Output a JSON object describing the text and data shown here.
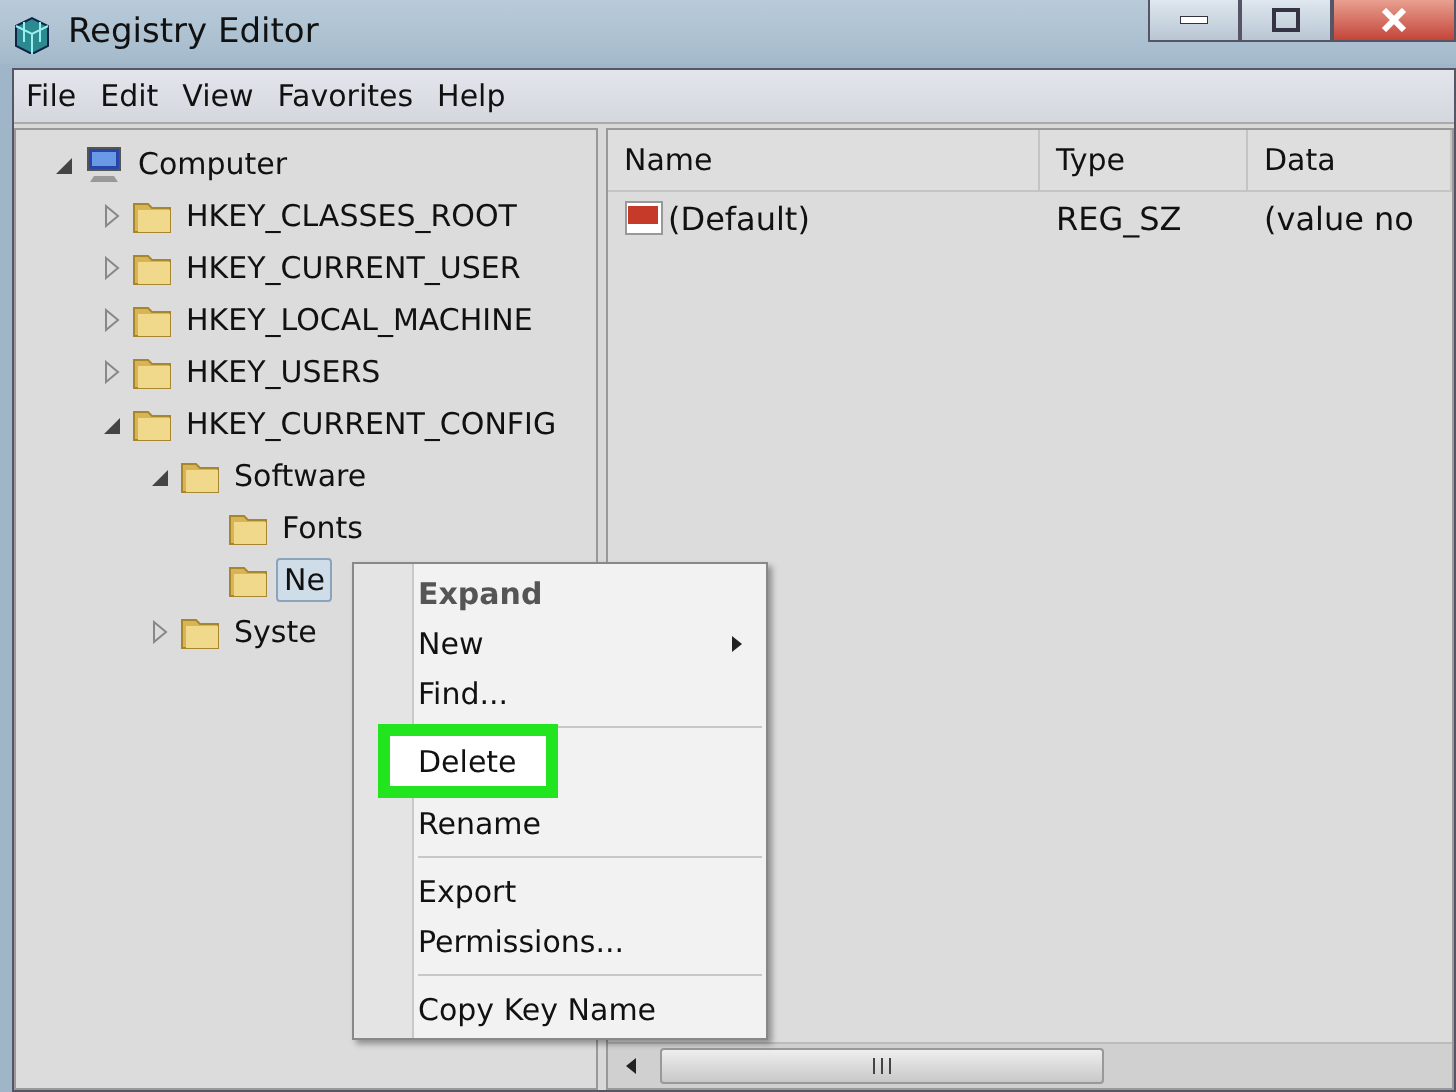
{
  "window": {
    "title": "Registry Editor"
  },
  "menu_bar": [
    "File",
    "Edit",
    "View",
    "Favorites",
    "Help"
  ],
  "tree": [
    {
      "label": "Computer",
      "kind": "computer",
      "expanded": true,
      "selected": false,
      "children": [
        {
          "label": "HKEY_CLASSES_ROOT",
          "kind": "folder",
          "expanded": false,
          "selected": false
        },
        {
          "label": "HKEY_CURRENT_USER",
          "kind": "folder",
          "expanded": false,
          "selected": false
        },
        {
          "label": "HKEY_LOCAL_MACHINE",
          "kind": "folder",
          "expanded": false,
          "selected": false
        },
        {
          "label": "HKEY_USERS",
          "kind": "folder",
          "expanded": false,
          "selected": false
        },
        {
          "label": "HKEY_CURRENT_CONFIG",
          "kind": "folder",
          "expanded": true,
          "selected": false,
          "children": [
            {
              "label": "Software",
              "kind": "folder",
              "expanded": true,
              "selected": false,
              "children": [
                {
                  "label": "Fonts",
                  "kind": "folder",
                  "expanded": false,
                  "selected": false
                },
                {
                  "label": "Ne",
                  "kind": "folder",
                  "expanded": false,
                  "selected": true
                }
              ]
            },
            {
              "label": "Syste",
              "kind": "folder",
              "expanded": false,
              "selected": false
            }
          ]
        }
      ]
    }
  ],
  "table": {
    "columns": [
      "Name",
      "Type",
      "Data"
    ],
    "rows": [
      {
        "name": "(Default)",
        "type": "REG_SZ",
        "data": "(value no"
      }
    ]
  },
  "context_menu": [
    {
      "label": "Expand",
      "kind": "item",
      "bold": true,
      "submenu": false,
      "highlighted": false
    },
    {
      "label": "New",
      "kind": "item",
      "bold": false,
      "submenu": true,
      "highlighted": false
    },
    {
      "label": "Find...",
      "kind": "item",
      "bold": false,
      "submenu": false,
      "highlighted": false
    },
    {
      "kind": "separator"
    },
    {
      "label": "Delete",
      "kind": "item",
      "bold": false,
      "submenu": false,
      "highlighted": true
    },
    {
      "label": "Rename",
      "kind": "item",
      "bold": false,
      "submenu": false,
      "highlighted": false
    },
    {
      "kind": "separator"
    },
    {
      "label": "Export",
      "kind": "item",
      "bold": false,
      "submenu": false,
      "highlighted": false
    },
    {
      "label": "Permissions...",
      "kind": "item",
      "bold": false,
      "submenu": false,
      "highlighted": false
    },
    {
      "kind": "separator"
    },
    {
      "label": "Copy Key Name",
      "kind": "item",
      "bold": false,
      "submenu": false,
      "highlighted": false
    }
  ]
}
